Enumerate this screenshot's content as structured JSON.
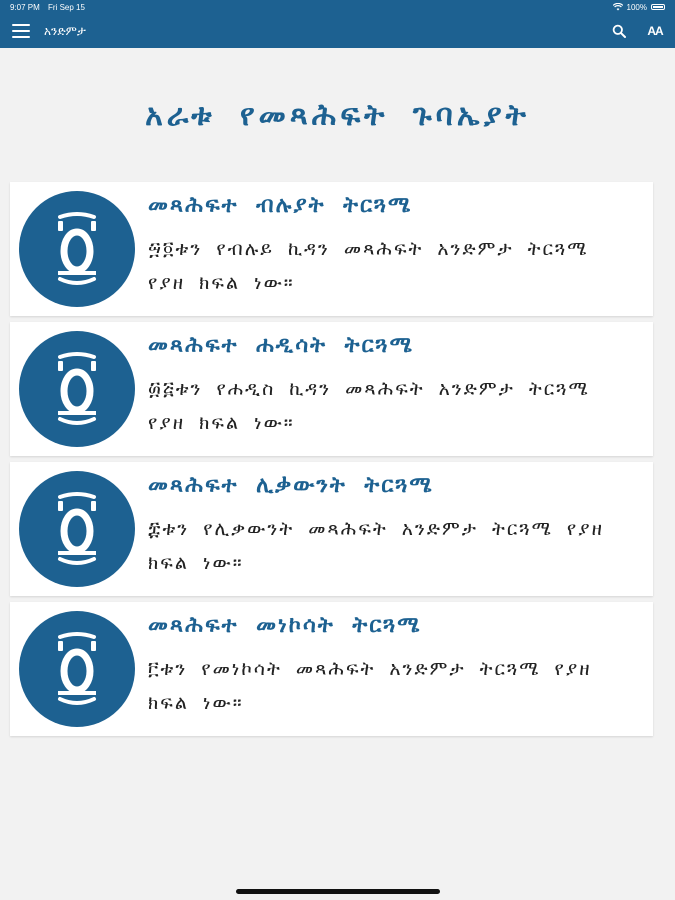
{
  "status_bar": {
    "time": "9:07 PM",
    "date": "Fri Sep 15",
    "battery": "100%"
  },
  "navbar": {
    "title": "አንድምታ",
    "search_icon": "search-icon",
    "text_size_label": "AA"
  },
  "page": {
    "heading": "አራቱ የመጻሕፍት ጉባኤያት"
  },
  "cards": [
    {
      "title": "መጻሕፍተ ብሉያት ትርጓሜ",
      "description": "፵፬ቱን የብሉይ ኪዳን መጻሕፍት አንድምታ ትርጓሜ የያዘ ክፍል ነው።",
      "icon": "book-icon"
    },
    {
      "title": "መጻሕፍተ ሐዲሳት ትርጓሜ",
      "description": "፴፭ቱን የሐዲስ ኪዳን መጻሕፍት አንድምታ ትርጓሜ የያዘ ክፍል ነው።",
      "icon": "book-icon"
    },
    {
      "title": "መጻሕፍተ ሊቃውንት ትርጓሜ",
      "description": "፰ቱን የሊቃውንት መጻሕፍት አንድምታ ትርጓሜ የያዘ ክፍል ነው።",
      "icon": "book-icon"
    },
    {
      "title": "መጻሕፍተ መነኮሳት ትርጓሜ",
      "description": "፫ቱን የመነኮሳት መጻሕፍት አንድምታ ትርጓሜ የያዘ ክፍል ነው።",
      "icon": "book-icon"
    }
  ],
  "colors": {
    "primary": "#1d6191",
    "background": "#f2f2f2",
    "card": "#ffffff"
  }
}
